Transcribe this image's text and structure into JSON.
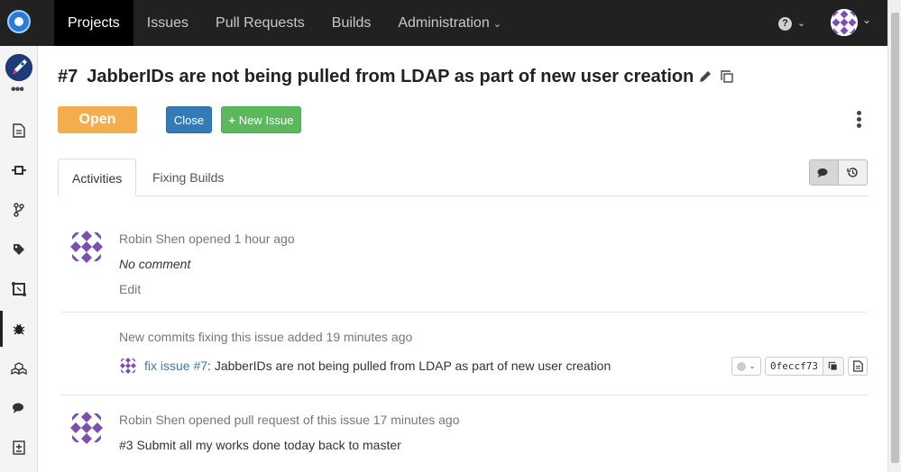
{
  "nav": {
    "items": [
      {
        "label": "Projects",
        "active": true
      },
      {
        "label": "Issues",
        "active": false
      },
      {
        "label": "Pull Requests",
        "active": false
      },
      {
        "label": "Builds",
        "active": false
      },
      {
        "label": "Administration",
        "active": false,
        "dropdown": true
      }
    ],
    "help_icon": "question-circle-icon"
  },
  "sidebar": {
    "icons": [
      "file-icon",
      "commit-icon",
      "branch-icon",
      "tag-icon",
      "pull-request-icon",
      "bug-icon",
      "cubes-icon",
      "comments-icon",
      "code-comment-icon"
    ],
    "active": "bug-icon"
  },
  "issue": {
    "number": "#7",
    "title": "JabberIDs are not being pulled from LDAP as part of new user creation",
    "state": "Open",
    "close_label": "Close",
    "new_issue_label": "New Issue"
  },
  "tabs": [
    {
      "label": "Activities",
      "active": true
    },
    {
      "label": "Fixing Builds",
      "active": false
    }
  ],
  "activities": [
    {
      "user": "Robin Shen",
      "action": "opened",
      "time": "1 hour ago",
      "comment": "No comment",
      "edit_label": "Edit"
    },
    {
      "header": "New commits fixing this issue added 19 minutes ago",
      "commit": {
        "prefix": "fix ",
        "issue_ref": "issue #7",
        "message": ": JabberIDs are not being pulled from LDAP as part of new user creation",
        "hash": "0feccf73"
      }
    },
    {
      "user": "Robin Shen",
      "action": "opened pull request of this issue",
      "time": "17 minutes ago",
      "pull_request": "#3 Submit all my works done today back to master"
    }
  ],
  "colors": {
    "navbar": "#212121",
    "open_state": "#f4ad4d",
    "close_button": "#337ab7",
    "new_issue_button": "#5cb85c",
    "avatar_purple": "#7b4fb0"
  }
}
